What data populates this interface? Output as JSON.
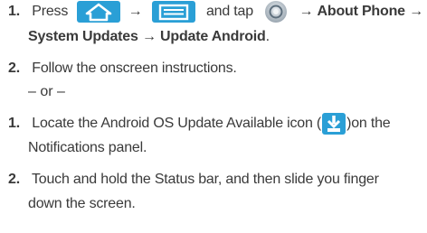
{
  "step1a": {
    "number": "1.",
    "text_press": "Press",
    "arrow1": "→",
    "text_and_tap": "and tap",
    "arrow2": "→",
    "about_phone": "About Phone",
    "arrow3": "→",
    "system_updates": "System Updates",
    "arrow4": "→",
    "update_android": "Update Android",
    "period": "."
  },
  "step2a": {
    "number": "2.",
    "text": "Follow the onscreen instructions."
  },
  "or_text": "– or –",
  "step1b": {
    "number": "1.",
    "text_before": "Locate the Android OS Update Available icon (",
    "text_after": ")on the",
    "line2": "Notifications panel."
  },
  "step2b": {
    "number": "2.",
    "line1": "Touch and hold the Status bar, and then slide you finger",
    "line2": "down the screen."
  },
  "colors": {
    "icon_blue": "#2a9fd6",
    "text": "#3a3a3a"
  }
}
